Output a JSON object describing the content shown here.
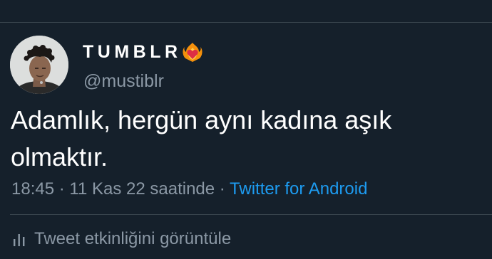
{
  "tweet": {
    "author": {
      "display_name": "TUMBLR",
      "name_emoji": "heart-on-fire-icon",
      "handle": "@mustiblr"
    },
    "text": "Adamlık, hergün aynı kadına aşık olmaktır.",
    "meta": {
      "time": "18:45",
      "separator": "·",
      "date": "11 Kas 22 saatinde",
      "source": "Twitter for Android"
    },
    "activity_label": "Tweet etkinliğini görüntüle"
  },
  "colors": {
    "background": "#15202b",
    "divider": "#38444d",
    "text_primary": "#ffffff",
    "text_secondary": "#8b98a5",
    "link": "#1d9bf0"
  }
}
